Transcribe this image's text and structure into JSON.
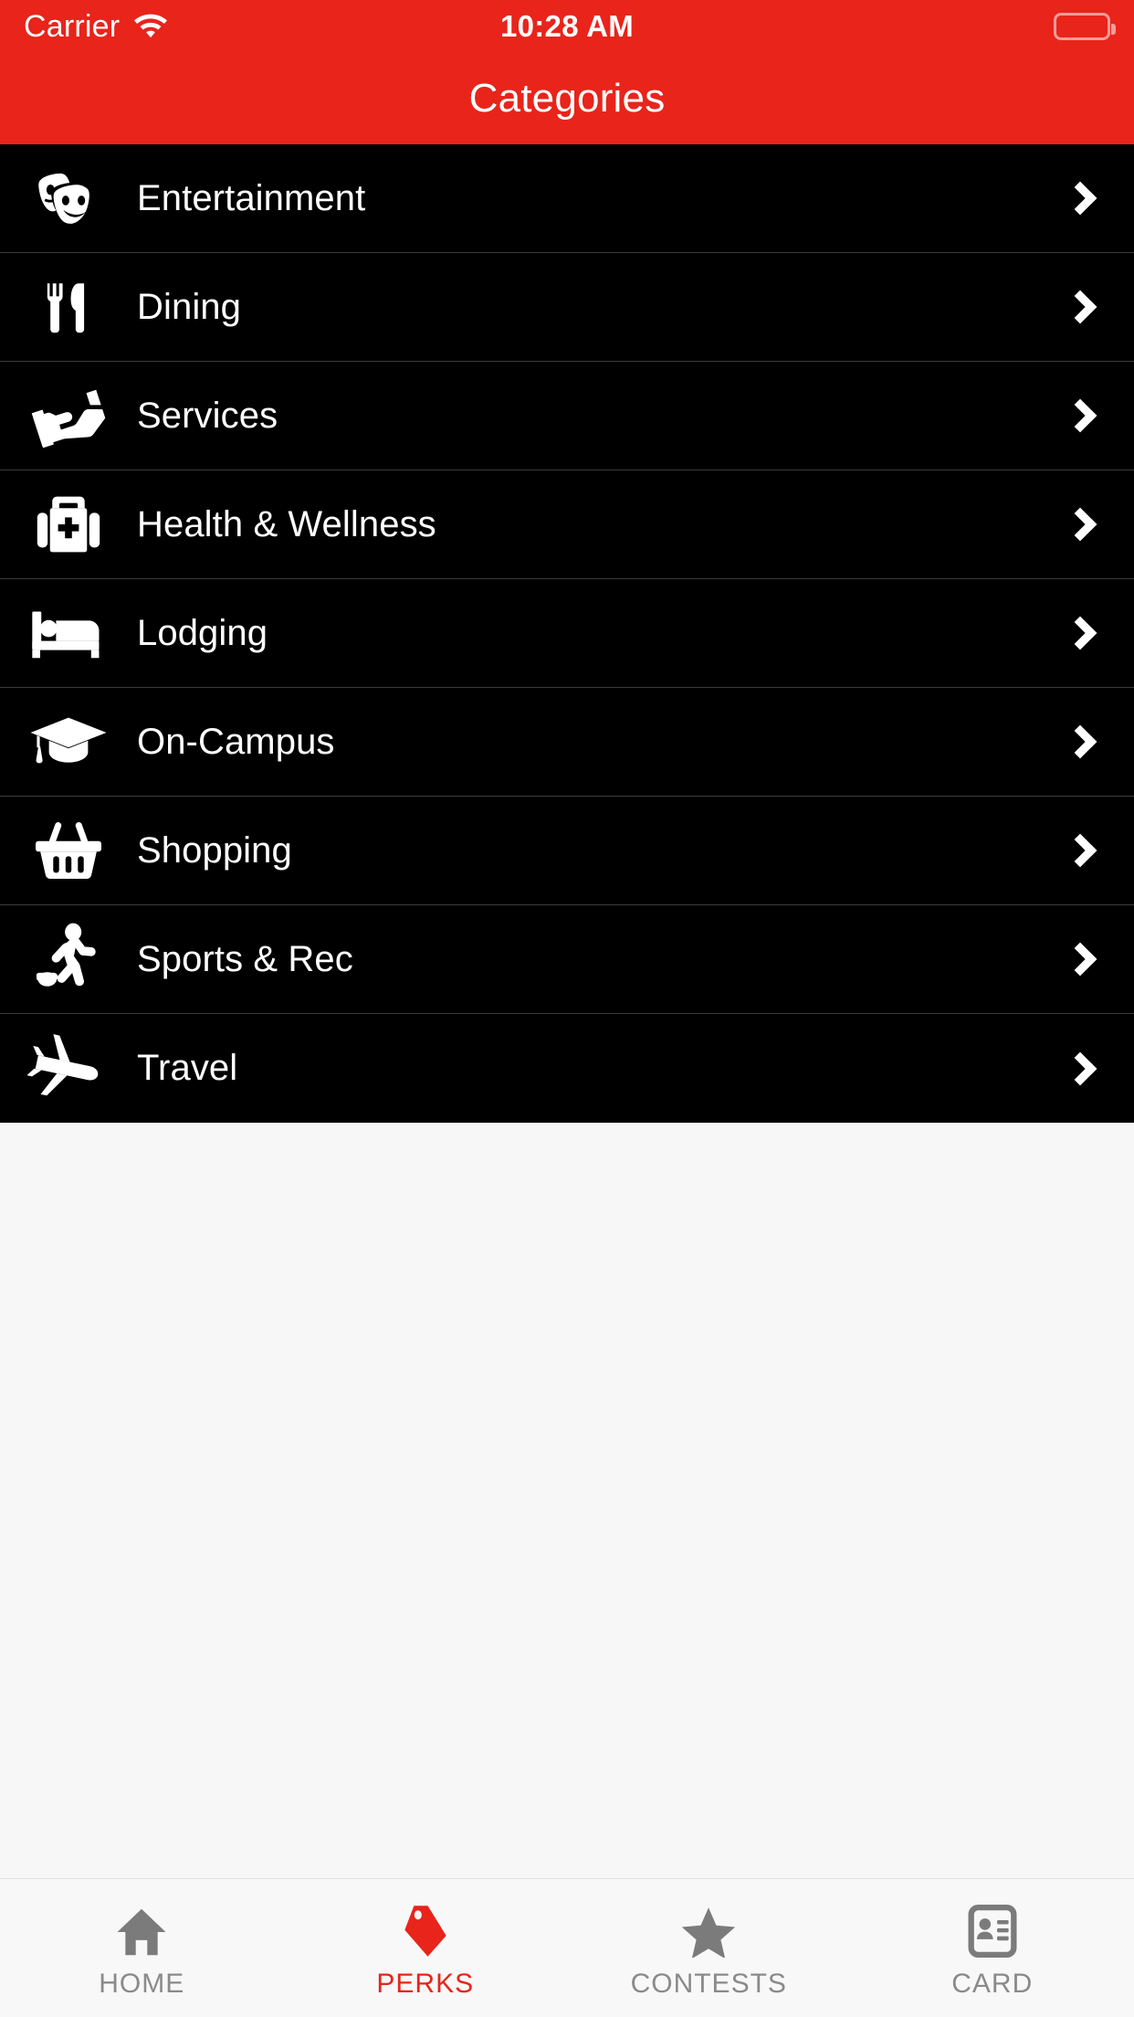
{
  "statusbar": {
    "carrier": "Carrier",
    "wifi_icon": "wifi-icon",
    "time": "10:28 AM",
    "battery_icon": "battery-full-icon"
  },
  "header": {
    "title": "Categories",
    "background_color": "#e8241b"
  },
  "list": {
    "background_color": "#000000",
    "items": [
      {
        "label": "Entertainment",
        "icon": "theater-masks-icon",
        "chevron": "chevron-right-icon"
      },
      {
        "label": "Dining",
        "icon": "fork-knife-icon",
        "chevron": "chevron-right-icon"
      },
      {
        "label": "Services",
        "icon": "handshake-icon",
        "chevron": "chevron-right-icon"
      },
      {
        "label": "Health & Wellness",
        "icon": "first-aid-kit-icon",
        "chevron": "chevron-right-icon"
      },
      {
        "label": "Lodging",
        "icon": "bed-icon",
        "chevron": "chevron-right-icon"
      },
      {
        "label": "On-Campus",
        "icon": "graduation-cap-icon",
        "chevron": "chevron-right-icon"
      },
      {
        "label": "Shopping",
        "icon": "shopping-basket-icon",
        "chevron": "chevron-right-icon"
      },
      {
        "label": "Sports & Rec",
        "icon": "running-person-icon",
        "chevron": "chevron-right-icon"
      },
      {
        "label": "Travel",
        "icon": "airplane-icon",
        "chevron": "chevron-right-icon"
      }
    ]
  },
  "tabbar": {
    "active_color": "#e8241b",
    "inactive_color": "#8a8a8a",
    "tabs": [
      {
        "label": "HOME",
        "icon": "home-icon",
        "active": false
      },
      {
        "label": "PERKS",
        "icon": "tag-icon",
        "active": true
      },
      {
        "label": "CONTESTS",
        "icon": "star-icon",
        "active": false
      },
      {
        "label": "CARD",
        "icon": "id-card-icon",
        "active": false
      }
    ]
  }
}
